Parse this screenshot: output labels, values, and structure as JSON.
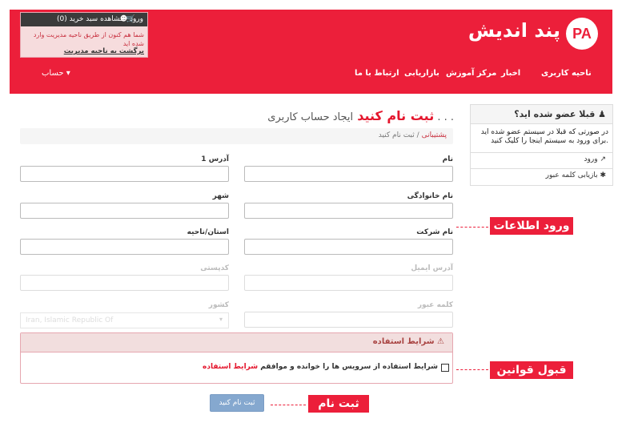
{
  "header": {
    "logo_badge": "PA",
    "logo_text": "پند اندیش",
    "topbar": {
      "login": "ورود",
      "cart": "مشاهده سبد خرید (0)"
    },
    "notice": "شما هم کنون از طریق ناحیه مدیریت وارد شده اید",
    "back_link": "برگشت به ناحیه مدیریت",
    "nav": [
      "ناحیه کاربری",
      "اخبار",
      "مرکز آموزش",
      "بازاریابی",
      "ارتباط با ما"
    ],
    "account": "حساب ▾"
  },
  "sidebar": {
    "title": "قبلا عضو شده اید؟",
    "desc": "در صورتی که قبلا در سیستم عضو شده اید برای ورود به سیستم اینجا را کلیک کنید.",
    "items": [
      {
        "label": "ورود",
        "icon": "login-icon"
      },
      {
        "label": "بازیابی کلمه عبور",
        "icon": "asterisk-icon"
      }
    ]
  },
  "page": {
    "title_red": "ثبت نام کنید",
    "title_sub": "ایجاد حساب کاربری . . .",
    "breadcrumb": {
      "link": "پشتیبانی",
      "sep": "/",
      "current": "ثبت نام کنید"
    }
  },
  "form": {
    "first_name": "نام",
    "last_name": "نام خانوادگی",
    "company": "نام شرکت",
    "email": "آدرس ایمیل",
    "password": "کلمه عبور",
    "address1": "آدرس 1",
    "city": "شهر",
    "state": "استان/ناحیه",
    "postcode": "کدپستی",
    "country_label": "کشور",
    "country_value": "Iran, Islamic Republic Of"
  },
  "tos": {
    "title": "شرایط استفاده",
    "text": "شرایط استفاده از سرویس ها را خوانده و موافقم",
    "link": "شرایط استفاده"
  },
  "submit_label": "ثبت نام کنید",
  "annotations": {
    "info": "ورود اطلاعات",
    "accept": "قبول قوانین",
    "register": "ثبت نام"
  },
  "colors": {
    "brand": "#ec1f3a",
    "submit": "#85a8cf"
  }
}
